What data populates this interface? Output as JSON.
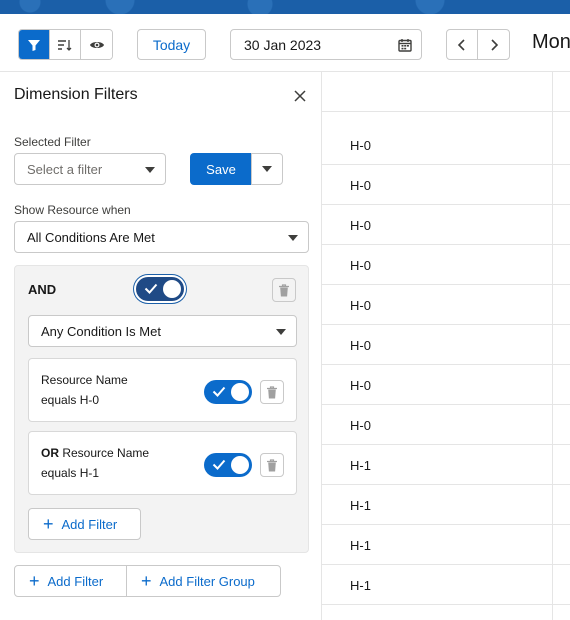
{
  "toolbar": {
    "today_label": "Today",
    "date_value": "30 Jan 2023",
    "view_label": "Mon"
  },
  "panel": {
    "title": "Dimension Filters",
    "selected_filter_label": "Selected Filter",
    "selected_filter_placeholder": "Select a filter",
    "save_label": "Save",
    "show_resource_label": "Show Resource when",
    "show_resource_value": "All Conditions Are Met",
    "group": {
      "operator": "AND",
      "condition_value": "Any Condition Is Met",
      "conditions": [
        {
          "prefix": "",
          "line1": "Resource Name",
          "line2": "equals H-0",
          "enabled": true
        },
        {
          "prefix": "OR",
          "line1": "Resource Name",
          "line2": "equals H-1",
          "enabled": true
        }
      ],
      "add_filter_label": "Add Filter"
    },
    "add_filter_label": "Add Filter",
    "add_filter_group_label": "Add Filter Group"
  },
  "grid": {
    "rows": [
      "H-0",
      "H-0",
      "H-0",
      "H-0",
      "H-0",
      "H-0",
      "H-0",
      "H-0",
      "H-1",
      "H-1",
      "H-1",
      "H-1"
    ]
  },
  "colors": {
    "brand": "#0b6bcb",
    "banner": "#1b5fa8"
  }
}
